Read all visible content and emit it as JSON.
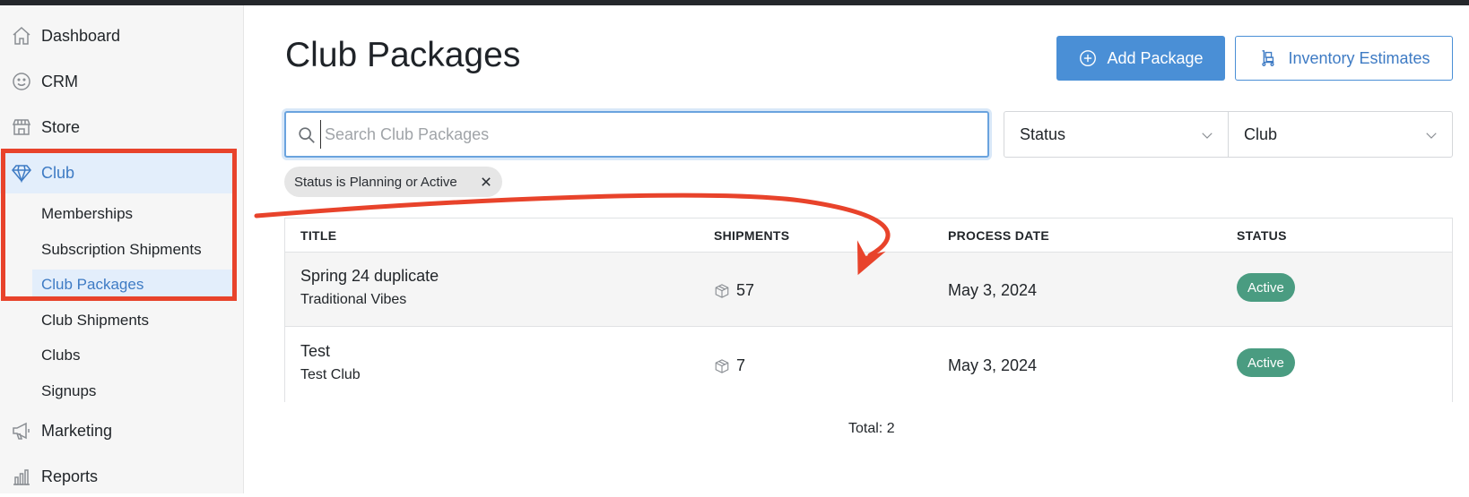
{
  "sidebar": {
    "items": [
      {
        "label": "Dashboard",
        "icon": "home-icon"
      },
      {
        "label": "CRM",
        "icon": "smiley-icon"
      },
      {
        "label": "Store",
        "icon": "storefront-icon"
      },
      {
        "label": "Club",
        "icon": "diamond-icon"
      },
      {
        "label": "Marketing",
        "icon": "megaphone-icon"
      },
      {
        "label": "Reports",
        "icon": "bar-chart-icon"
      }
    ],
    "club_subitems": [
      "Memberships",
      "Subscription Shipments",
      "Club Packages",
      "Club Shipments",
      "Clubs",
      "Signups"
    ],
    "active_item": "Club",
    "active_subitem": "Club Packages"
  },
  "header": {
    "title": "Club Packages",
    "add_button": "Add Package",
    "inventory_button": "Inventory Estimates"
  },
  "filters": {
    "search_placeholder": "Search Club Packages",
    "search_value": "",
    "status_select": "Status",
    "club_select": "Club",
    "active_chip": "Status is Planning or Active"
  },
  "table": {
    "columns": [
      "TITLE",
      "SHIPMENTS",
      "PROCESS DATE",
      "STATUS"
    ],
    "rows": [
      {
        "title": "Spring 24 duplicate",
        "club": "Traditional Vibes",
        "shipments": "57",
        "process_date": "May 3, 2024",
        "status": "Active"
      },
      {
        "title": "Test",
        "club": "Test Club",
        "shipments": "7",
        "process_date": "May 3, 2024",
        "status": "Active"
      }
    ],
    "total": "Total: 2"
  },
  "colors": {
    "accent": "#4a8fd6",
    "active_nav_bg": "#e3eefb",
    "status_active": "#4a9c81",
    "annotation_red": "#e8432b"
  }
}
